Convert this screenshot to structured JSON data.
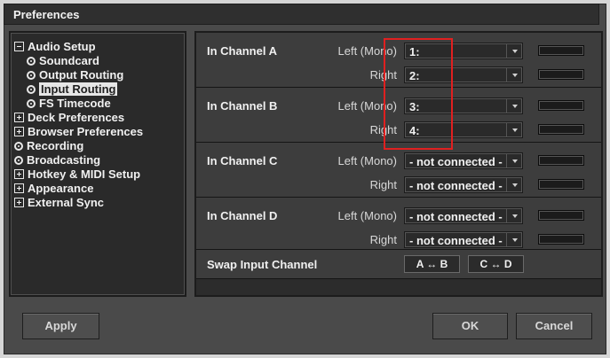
{
  "window": {
    "title": "Preferences"
  },
  "sidebar": {
    "items": [
      {
        "label": "Audio Setup",
        "icon": "minus-box-icon",
        "level": 0
      },
      {
        "label": "Soundcard",
        "icon": "radio-icon",
        "level": 1
      },
      {
        "label": "Output Routing",
        "icon": "radio-icon",
        "level": 1
      },
      {
        "label": "Input Routing",
        "icon": "radio-icon",
        "level": 1,
        "selected": true
      },
      {
        "label": "FS Timecode",
        "icon": "radio-icon",
        "level": 1
      },
      {
        "label": "Deck Preferences",
        "icon": "plus-box-icon",
        "level": 0
      },
      {
        "label": "Browser Preferences",
        "icon": "plus-box-icon",
        "level": 0
      },
      {
        "label": "Recording",
        "icon": "radio-icon",
        "level": 0
      },
      {
        "label": "Broadcasting",
        "icon": "radio-icon",
        "level": 0
      },
      {
        "label": "Hotkey & MIDI Setup",
        "icon": "plus-box-icon",
        "level": 0
      },
      {
        "label": "Appearance",
        "icon": "plus-box-icon",
        "level": 0
      },
      {
        "label": "External Sync",
        "icon": "plus-box-icon",
        "level": 0
      }
    ]
  },
  "channels": [
    {
      "title": "In Channel A",
      "left_label": "Left (Mono)",
      "left_value": "1:",
      "right_label": "Right",
      "right_value": "2:"
    },
    {
      "title": "In Channel B",
      "left_label": "Left (Mono)",
      "left_value": "3:",
      "right_label": "Right",
      "right_value": "4:"
    },
    {
      "title": "In Channel C",
      "left_label": "Left (Mono)",
      "left_value": "- not connected -",
      "right_label": "Right",
      "right_value": "- not connected -"
    },
    {
      "title": "In Channel D",
      "left_label": "Left (Mono)",
      "left_value": "- not connected -",
      "right_label": "Right",
      "right_value": "- not connected -"
    }
  ],
  "swap": {
    "title": "Swap Input Channel",
    "ab_label": "A ↔ B",
    "cd_label": "C ↔ D"
  },
  "buttons": {
    "apply": "Apply",
    "ok": "OK",
    "cancel": "Cancel"
  },
  "colors": {
    "highlight": "#e02020",
    "selection": "#e6e6e6"
  }
}
